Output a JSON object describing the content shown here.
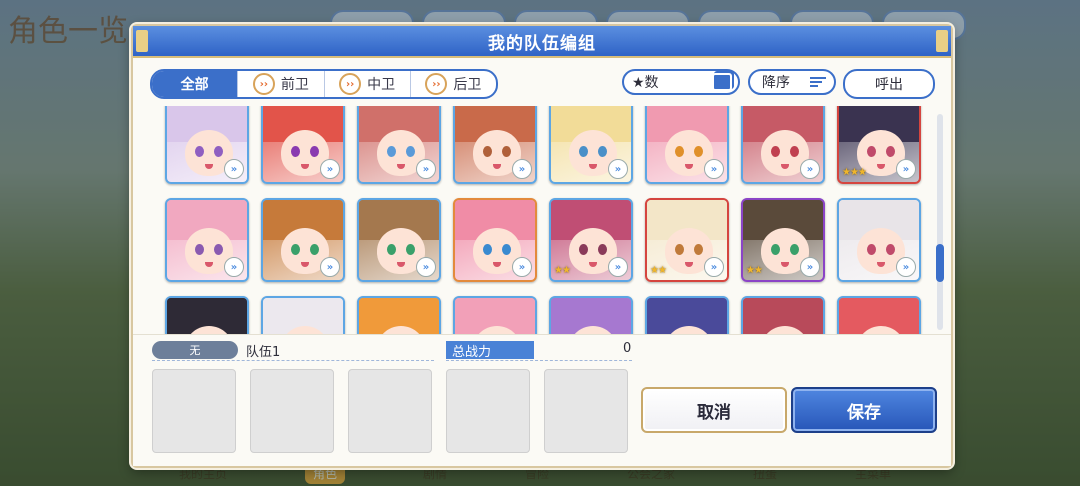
{
  "background": {
    "title": "角色一览",
    "bottom_nav": [
      "我的主页",
      "角色",
      "剧情",
      "冒险",
      "公会之家",
      "扭蛋",
      "主菜单"
    ],
    "bottom_nav_active": 1
  },
  "dialog": {
    "title": "我的队伍编组",
    "filters": [
      {
        "label": "全部",
        "icon": "",
        "active": true
      },
      {
        "label": "前卫",
        "icon": "vanguard-icon",
        "active": false
      },
      {
        "label": "中卫",
        "icon": "midguard-icon",
        "active": false
      },
      {
        "label": "后卫",
        "icon": "rearguard-icon",
        "active": false
      }
    ],
    "sort_field": "★数",
    "sort_order": "降序",
    "call_label": "呼出",
    "colors": {
      "accent": "#3b6fc9",
      "header": "#2f63c6",
      "gold": "#d8bd7a"
    }
  },
  "characters": [
    {
      "hair": "#d9c6ea",
      "eye": "#8f5fc1",
      "rarity": "blue",
      "stars": ""
    },
    {
      "hair": "#e2544a",
      "eye": "#8a3ab0",
      "rarity": "blue",
      "stars": ""
    },
    {
      "hair": "#d0706a",
      "eye": "#5a9ad8",
      "rarity": "blue",
      "stars": ""
    },
    {
      "hair": "#c96a4a",
      "eye": "#b0603a",
      "rarity": "blue",
      "stars": ""
    },
    {
      "hair": "#f2dc98",
      "eye": "#4a90c8",
      "rarity": "blue",
      "stars": ""
    },
    {
      "hair": "#f09ab0",
      "eye": "#e0902a",
      "rarity": "blue",
      "stars": ""
    },
    {
      "hair": "#c65a66",
      "eye": "#c04050",
      "rarity": "blue",
      "stars": ""
    },
    {
      "hair": "#3a3350",
      "eye": "#c04a6a",
      "rarity": "red",
      "stars": "★★★"
    },
    {
      "hair": "#f1a8c0",
      "eye": "#8a5ab0",
      "rarity": "blue",
      "stars": ""
    },
    {
      "hair": "#c67a3a",
      "eye": "#3aa06a",
      "rarity": "blue",
      "stars": ""
    },
    {
      "hair": "#a4784e",
      "eye": "#3aa06a",
      "rarity": "blue",
      "stars": ""
    },
    {
      "hair": "#f08ca6",
      "eye": "#3a8ad0",
      "rarity": "orange",
      "stars": ""
    },
    {
      "hair": "#c04e74",
      "eye": "#8a3a5a",
      "rarity": "blue",
      "stars": "★★"
    },
    {
      "hair": "#f3e6c8",
      "eye": "#c07a3a",
      "rarity": "red",
      "stars": "★★"
    },
    {
      "hair": "#5a4a3a",
      "eye": "#3aa06a",
      "rarity": "purple",
      "stars": "★★"
    },
    {
      "hair": "#e8e4e8",
      "eye": "#c04a6a",
      "rarity": "blue",
      "stars": ""
    },
    {
      "hair": "#2e2a36",
      "eye": "#3aa06a",
      "rarity": "blue",
      "stars": ""
    },
    {
      "hair": "#ece8ee",
      "eye": "#c04a6a",
      "rarity": "blue",
      "stars": ""
    },
    {
      "hair": "#f09a3a",
      "eye": "#3a8ad0",
      "rarity": "blue",
      "stars": ""
    },
    {
      "hair": "#f2a0b8",
      "eye": "#c04a6a",
      "rarity": "blue",
      "stars": ""
    },
    {
      "hair": "#a678d0",
      "eye": "#6a3ab0",
      "rarity": "blue",
      "stars": ""
    },
    {
      "hair": "#4a4a9a",
      "eye": "#c04050",
      "rarity": "blue",
      "stars": ""
    },
    {
      "hair": "#b84a5a",
      "eye": "#c04050",
      "rarity": "blue",
      "stars": ""
    },
    {
      "hair": "#e45a60",
      "eye": "#c04050",
      "rarity": "blue",
      "stars": ""
    }
  ],
  "team": {
    "none_badge": "无",
    "name": "队伍1",
    "power_label": "总战力",
    "power_value": "0",
    "slot_count": 5,
    "cancel_label": "取消",
    "save_label": "保存"
  }
}
